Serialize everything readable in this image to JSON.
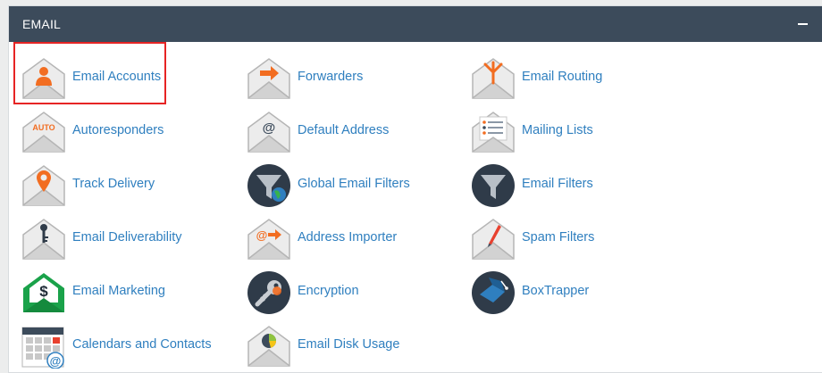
{
  "panel": {
    "title": "EMAIL",
    "collapse_icon": "minus-icon"
  },
  "items": [
    {
      "label": "Email Accounts",
      "icon": "email-accounts-icon"
    },
    {
      "label": "Forwarders",
      "icon": "forwarders-icon"
    },
    {
      "label": "Email Routing",
      "icon": "email-routing-icon"
    },
    {
      "label": "Autoresponders",
      "icon": "autoresponders-icon",
      "badge": "AUTO"
    },
    {
      "label": "Default Address",
      "icon": "default-address-icon",
      "badge": "@"
    },
    {
      "label": "Mailing Lists",
      "icon": "mailing-lists-icon"
    },
    {
      "label": "Track Delivery",
      "icon": "track-delivery-icon"
    },
    {
      "label": "Global Email Filters",
      "icon": "global-email-filters-icon"
    },
    {
      "label": "Email Filters",
      "icon": "email-filters-icon"
    },
    {
      "label": "Email Deliverability",
      "icon": "email-deliverability-icon"
    },
    {
      "label": "Address Importer",
      "icon": "address-importer-icon",
      "badge": "@"
    },
    {
      "label": "Spam Filters",
      "icon": "spam-filters-icon"
    },
    {
      "label": "Email Marketing",
      "icon": "email-marketing-icon",
      "badge": "$"
    },
    {
      "label": "Encryption",
      "icon": "encryption-icon"
    },
    {
      "label": "BoxTrapper",
      "icon": "boxtrapper-icon"
    },
    {
      "label": "Calendars and Contacts",
      "icon": "calendars-and-contacts-icon",
      "badge": "@"
    },
    {
      "label": "Email Disk Usage",
      "icon": "email-disk-usage-icon"
    }
  ],
  "colors": {
    "header_bg": "#3c4b5b",
    "link": "#2f7fbf",
    "accent_orange": "#f26d21",
    "highlight_border": "#e62424",
    "green": "#1aa24a",
    "dark_circle": "#2f3b49"
  }
}
